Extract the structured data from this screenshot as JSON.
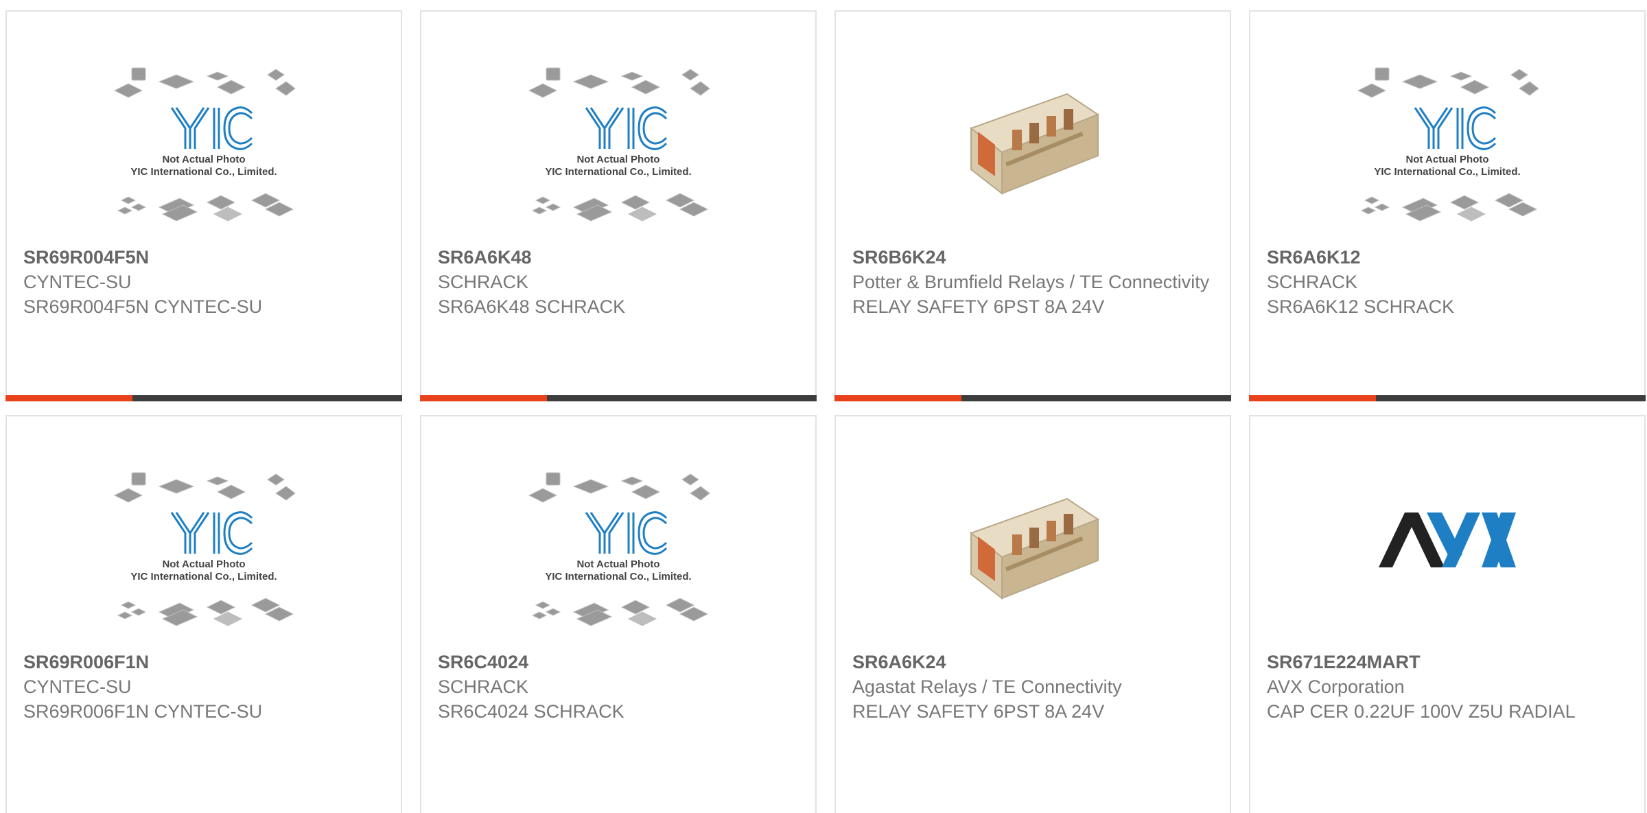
{
  "colors": {
    "accent": "#e8411b",
    "track": "#3d3d3d",
    "border": "#e2e2e2",
    "text": "#666666",
    "yic_logo": "#1f7fc4"
  },
  "placeholder": {
    "line1": "Not Actual Photo",
    "line2": "YIC International Co., Limited.",
    "logo_text": "YIC"
  },
  "avx_logo_text": "AVX",
  "products": [
    {
      "part": "SR69R004F5N",
      "manufacturer": "CYNTEC-SU",
      "description": "SR69R004F5N CYNTEC-SU",
      "image": "placeholder",
      "progress": 0.32
    },
    {
      "part": "SR6A6K48",
      "manufacturer": "SCHRACK",
      "description": "SR6A6K48 SCHRACK",
      "image": "placeholder",
      "progress": 0.32
    },
    {
      "part": "SR6B6K24",
      "manufacturer": "Potter & Brumfield Relays / TE Connectivity",
      "description": "RELAY SAFETY 6PST 8A 24V",
      "image": "relay-photo",
      "progress": 0.32
    },
    {
      "part": "SR6A6K12",
      "manufacturer": "SCHRACK",
      "description": "SR6A6K12 SCHRACK",
      "image": "placeholder",
      "progress": 0.32
    },
    {
      "part": "SR69R006F1N",
      "manufacturer": "CYNTEC-SU",
      "description": "SR69R006F1N CYNTEC-SU",
      "image": "placeholder"
    },
    {
      "part": "SR6C4024",
      "manufacturer": "SCHRACK",
      "description": "SR6C4024 SCHRACK",
      "image": "placeholder"
    },
    {
      "part": "SR6A6K24",
      "manufacturer": "Agastat Relays / TE Connectivity",
      "description": "RELAY SAFETY 6PST 8A 24V",
      "image": "relay-photo"
    },
    {
      "part": "SR671E224MART",
      "manufacturer": "AVX Corporation",
      "description": "CAP CER 0.22UF 100V Z5U RADIAL",
      "image": "avx-logo"
    }
  ]
}
